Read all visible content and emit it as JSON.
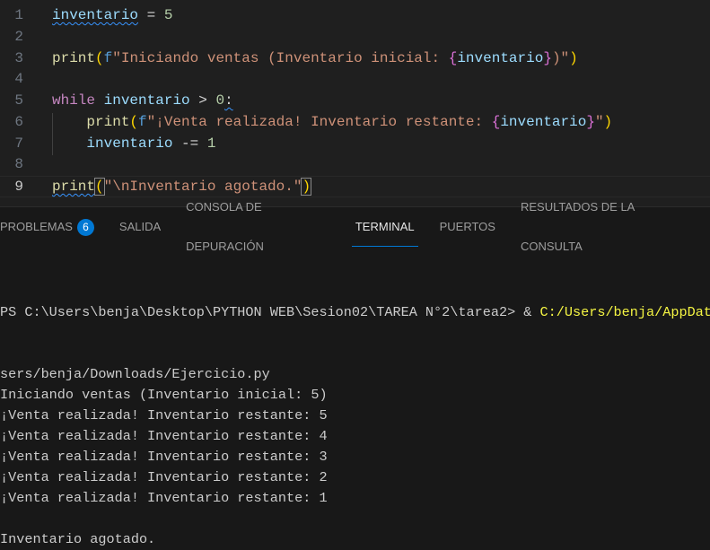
{
  "editor": {
    "current_line": 9,
    "lines": [
      {
        "n": "1",
        "tokens": [
          {
            "t": "inventario",
            "c": "var squig"
          },
          {
            "t": " = ",
            "c": "op"
          },
          {
            "t": "5",
            "c": "num"
          }
        ]
      },
      {
        "n": "2",
        "tokens": []
      },
      {
        "n": "3",
        "tokens": [
          {
            "t": "print",
            "c": "fn"
          },
          {
            "t": "(",
            "c": "p1"
          },
          {
            "t": "f",
            "c": "kw"
          },
          {
            "t": "\"Iniciando ventas (Inventario inicial: ",
            "c": "str"
          },
          {
            "t": "{",
            "c": "br"
          },
          {
            "t": "inventario",
            "c": "var"
          },
          {
            "t": "}",
            "c": "br"
          },
          {
            "t": ")\"",
            "c": "str"
          },
          {
            "t": ")",
            "c": "p1"
          }
        ]
      },
      {
        "n": "4",
        "tokens": []
      },
      {
        "n": "5",
        "tokens": [
          {
            "t": "while",
            "c": "ctl"
          },
          {
            "t": " ",
            "c": "op"
          },
          {
            "t": "inventario",
            "c": "var"
          },
          {
            "t": " > ",
            "c": "op"
          },
          {
            "t": "0",
            "c": "num"
          },
          {
            "t": ":",
            "c": "op squig"
          }
        ]
      },
      {
        "n": "6",
        "tokens": [
          {
            "t": "    ",
            "c": "op"
          },
          {
            "t": "print",
            "c": "fn"
          },
          {
            "t": "(",
            "c": "p1"
          },
          {
            "t": "f",
            "c": "kw"
          },
          {
            "t": "\"¡Venta realizada! Inventario restante: ",
            "c": "str"
          },
          {
            "t": "{",
            "c": "br"
          },
          {
            "t": "inventario",
            "c": "var"
          },
          {
            "t": "}",
            "c": "br"
          },
          {
            "t": "\"",
            "c": "str"
          },
          {
            "t": ")",
            "c": "p1"
          }
        ]
      },
      {
        "n": "7",
        "tokens": [
          {
            "t": "    ",
            "c": "op"
          },
          {
            "t": "inventario",
            "c": "var"
          },
          {
            "t": " -= ",
            "c": "op"
          },
          {
            "t": "1",
            "c": "num"
          }
        ]
      },
      {
        "n": "8",
        "tokens": []
      },
      {
        "n": "9",
        "tokens": [
          {
            "t": "print",
            "c": "fn squig"
          },
          {
            "t": "(",
            "c": "p1 bm"
          },
          {
            "t": "\"\\nInventario agotado.\"",
            "c": "str"
          },
          {
            "t": ")",
            "c": "p1 bm"
          }
        ]
      }
    ]
  },
  "panel": {
    "tabs": [
      {
        "label": "PROBLEMAS",
        "badge": "6"
      },
      {
        "label": "SALIDA"
      },
      {
        "label": "CONSOLA DE DEPURACIÓN"
      },
      {
        "label": "TERMINAL",
        "active": true
      },
      {
        "label": "PUERTOS"
      },
      {
        "label": "RESULTADOS DE LA CONSULTA"
      }
    ],
    "terminal": {
      "prompt": "PS C:\\Users\\benja\\Desktop\\PYTHON WEB\\Sesion02\\TAREA N°2\\tarea2> ",
      "amp": "& ",
      "command": "C:/Users/benja/AppData",
      "output": [
        "sers/benja/Downloads/Ejercicio.py",
        "Iniciando ventas (Inventario inicial: 5)",
        "¡Venta realizada! Inventario restante: 5",
        "¡Venta realizada! Inventario restante: 4",
        "¡Venta realizada! Inventario restante: 3",
        "¡Venta realizada! Inventario restante: 2",
        "¡Venta realizada! Inventario restante: 1",
        "",
        "Inventario agotado."
      ]
    }
  }
}
